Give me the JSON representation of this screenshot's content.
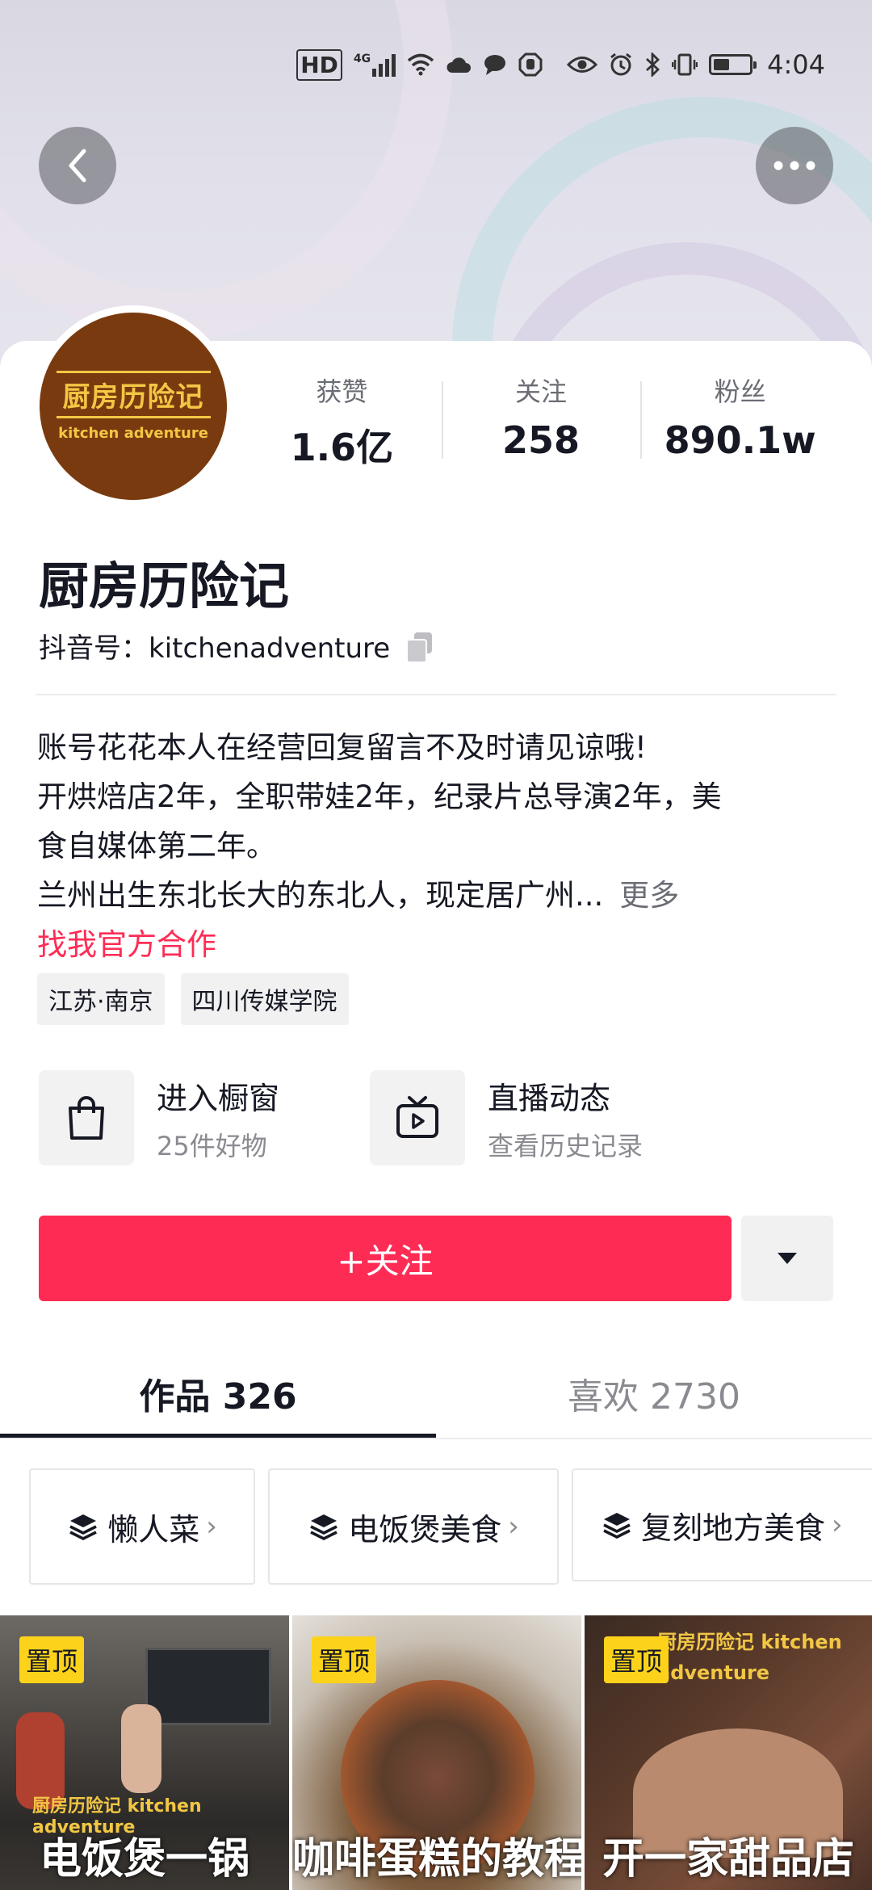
{
  "status_bar": {
    "hd": "HD",
    "network": "4G",
    "time": "4:04",
    "icons": [
      "hd-icon",
      "signal-icon",
      "wifi-icon",
      "cloud-icon",
      "chat-icon",
      "hand-icon",
      "eye-icon",
      "alarm-icon",
      "bluetooth-icon",
      "vibrate-icon",
      "battery-icon"
    ]
  },
  "header": {
    "back_icon": "chevron-left-icon",
    "more_icon": "ellipsis-icon"
  },
  "profile": {
    "avatar_text": "厨房历险记",
    "avatar_subtext": "kitchen adventure",
    "name": "厨房历险记",
    "id_label": "抖音号：kitchenadventure",
    "stats": [
      {
        "label": "获赞",
        "value": "1.6亿"
      },
      {
        "label": "关注",
        "value": "258"
      },
      {
        "label": "粉丝",
        "value": "890.1w"
      }
    ],
    "bio_lines": [
      "账号花花本人在经营回复留言不及时请见谅哦!",
      "开烘焙店2年，全职带娃2年，纪录片总导演2年，美",
      "食自媒体第二年。",
      "兰州出生东北长大的东北人，现定居广州..."
    ],
    "more_label": "更多",
    "biz_link": "找我官方合作",
    "tags": [
      "江苏·南京",
      "四川传媒学院"
    ]
  },
  "shortcuts": [
    {
      "title": "进入橱窗",
      "subtitle": "25件好物",
      "icon": "shopping-bag-icon"
    },
    {
      "title": "直播动态",
      "subtitle": "查看历史记录",
      "icon": "tv-play-icon"
    }
  ],
  "actions": {
    "follow_label": "+关注"
  },
  "tabs": [
    {
      "label": "作品 326",
      "active": true
    },
    {
      "label": "喜欢 2730",
      "active": false
    }
  ],
  "collections": [
    {
      "label": "懒人菜"
    },
    {
      "label": "电饭煲美食"
    },
    {
      "label": "复刻地方美食"
    }
  ],
  "videos": [
    {
      "pin": "置顶",
      "caption": "电饭煲一锅",
      "brand": "厨房历险记 kitchen adventure"
    },
    {
      "pin": "置顶",
      "caption": "咖啡蛋糕的教程",
      "brand": ""
    },
    {
      "pin": "置顶",
      "caption": "开一家甜品店",
      "brand": "厨房历险记 kitchen adventure"
    }
  ],
  "colors": {
    "accent": "#fe2c55",
    "pin_badge": "#fcd31a",
    "avatar_bg": "#7a3a0f",
    "avatar_text": "#f2c744"
  }
}
